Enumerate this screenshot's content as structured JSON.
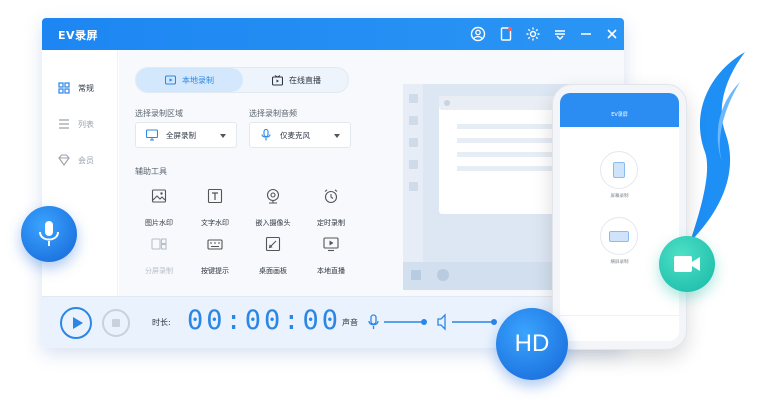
{
  "window": {
    "title": "EV录屏"
  },
  "sidebar": {
    "items": [
      {
        "label": "常规",
        "icon": "grid-icon"
      },
      {
        "label": "列表",
        "icon": "list-icon"
      },
      {
        "label": "会员",
        "icon": "diamond-icon"
      }
    ]
  },
  "mode_tabs": [
    {
      "label": "本地录制",
      "icon": "record-screen-icon"
    },
    {
      "label": "在线直播",
      "icon": "live-icon"
    }
  ],
  "area": {
    "label": "选择录制区域",
    "value": "全屏录制"
  },
  "audio": {
    "label": "选择录制音频",
    "value": "仅麦克风"
  },
  "tools": {
    "label": "辅助工具",
    "items": [
      {
        "label": "图片水印",
        "icon": "image-icon",
        "enabled": true
      },
      {
        "label": "文字水印",
        "icon": "text-icon",
        "enabled": true
      },
      {
        "label": "嵌入摄像头",
        "icon": "webcam-icon",
        "enabled": true
      },
      {
        "label": "定时录制",
        "icon": "alarm-icon",
        "enabled": true
      },
      {
        "label": "分屏录制",
        "icon": "split-screen-icon",
        "enabled": false
      },
      {
        "label": "按键提示",
        "icon": "keyboard-icon",
        "enabled": true
      },
      {
        "label": "桌面画板",
        "icon": "pen-icon",
        "enabled": true
      },
      {
        "label": "本地直播",
        "icon": "broadcast-icon",
        "enabled": true
      }
    ]
  },
  "bottom": {
    "duration_label": "时长:",
    "timer": "00:00:00",
    "volume_label": "声音"
  },
  "phone": {
    "title": "EV录屏",
    "btn1_label": "屏幕录制",
    "btn2_label": "横屏录制"
  },
  "badges": {
    "hd": "HD"
  },
  "colors": {
    "accent": "#2b86e6",
    "titlebar": "#1d86f2",
    "cam_badge": "#16b8a6"
  }
}
